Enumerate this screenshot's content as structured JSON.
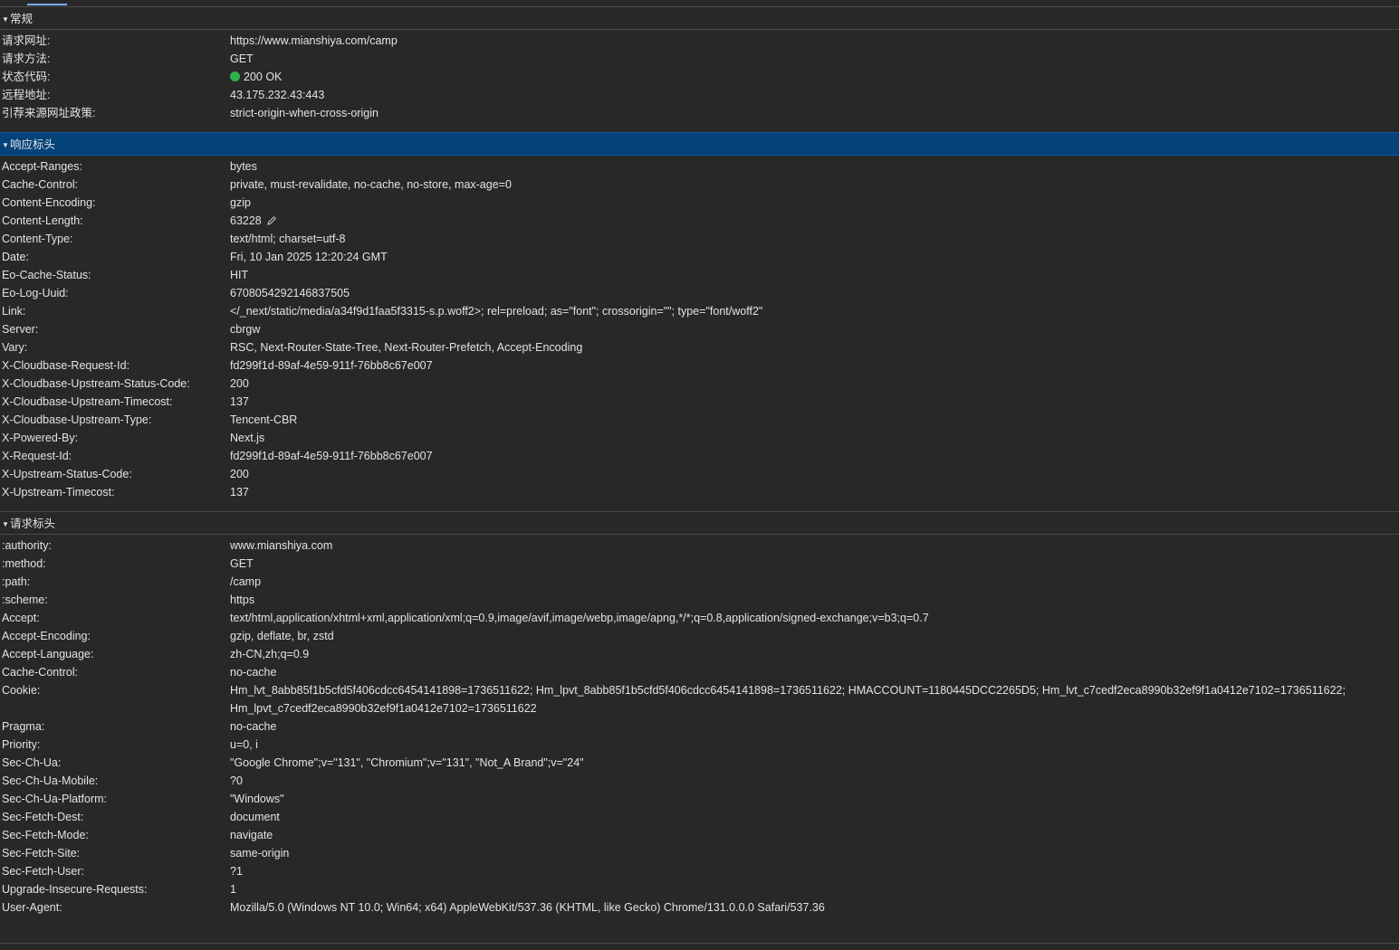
{
  "colors": {
    "background": "#282828",
    "selected_header": "#04427a",
    "status_ok": "#2fb14a"
  },
  "general": {
    "title": "常规",
    "rows": [
      {
        "k": "请求网址:",
        "v": "https://www.mianshiya.com/camp"
      },
      {
        "k": "请求方法:",
        "v": "GET"
      },
      {
        "k": "状态代码:",
        "v": "200 OK"
      },
      {
        "k": "远程地址:",
        "v": "43.175.232.43:443"
      },
      {
        "k": "引荐来源网址政策:",
        "v": "strict-origin-when-cross-origin"
      }
    ]
  },
  "response_headers": {
    "title": "响应标头",
    "rows": [
      {
        "k": "Accept-Ranges:",
        "v": "bytes"
      },
      {
        "k": "Cache-Control:",
        "v": "private, must-revalidate, no-cache, no-store, max-age=0"
      },
      {
        "k": "Content-Encoding:",
        "v": "gzip"
      },
      {
        "k": "Content-Length:",
        "v": "63228"
      },
      {
        "k": "Content-Type:",
        "v": "text/html; charset=utf-8"
      },
      {
        "k": "Date:",
        "v": "Fri, 10 Jan 2025 12:20:24 GMT"
      },
      {
        "k": "Eo-Cache-Status:",
        "v": "HIT"
      },
      {
        "k": "Eo-Log-Uuid:",
        "v": "6708054292146837505"
      },
      {
        "k": "Link:",
        "v": "</_next/static/media/a34f9d1faa5f3315-s.p.woff2>; rel=preload; as=\"font\"; crossorigin=\"\"; type=\"font/woff2\""
      },
      {
        "k": "Server:",
        "v": "cbrgw"
      },
      {
        "k": "Vary:",
        "v": "RSC, Next-Router-State-Tree, Next-Router-Prefetch, Accept-Encoding"
      },
      {
        "k": "X-Cloudbase-Request-Id:",
        "v": "fd299f1d-89af-4e59-911f-76bb8c67e007"
      },
      {
        "k": "X-Cloudbase-Upstream-Status-Code:",
        "v": "200"
      },
      {
        "k": "X-Cloudbase-Upstream-Timecost:",
        "v": "137"
      },
      {
        "k": "X-Cloudbase-Upstream-Type:",
        "v": "Tencent-CBR"
      },
      {
        "k": "X-Powered-By:",
        "v": "Next.js"
      },
      {
        "k": "X-Request-Id:",
        "v": "fd299f1d-89af-4e59-911f-76bb8c67e007"
      },
      {
        "k": "X-Upstream-Status-Code:",
        "v": "200"
      },
      {
        "k": "X-Upstream-Timecost:",
        "v": "137"
      }
    ]
  },
  "request_headers": {
    "title": "请求标头",
    "rows": [
      {
        "k": ":authority:",
        "v": "www.mianshiya.com"
      },
      {
        "k": ":method:",
        "v": "GET"
      },
      {
        "k": ":path:",
        "v": "/camp"
      },
      {
        "k": ":scheme:",
        "v": "https"
      },
      {
        "k": "Accept:",
        "v": "text/html,application/xhtml+xml,application/xml;q=0.9,image/avif,image/webp,image/apng,*/*;q=0.8,application/signed-exchange;v=b3;q=0.7"
      },
      {
        "k": "Accept-Encoding:",
        "v": "gzip, deflate, br, zstd"
      },
      {
        "k": "Accept-Language:",
        "v": "zh-CN,zh;q=0.9"
      },
      {
        "k": "Cache-Control:",
        "v": "no-cache"
      },
      {
        "k": "Cookie:",
        "v": "Hm_lvt_8abb85f1b5cfd5f406cdcc6454141898=1736511622; Hm_lpvt_8abb85f1b5cfd5f406cdcc6454141898=1736511622; HMACCOUNT=1180445DCC2265D5; Hm_lvt_c7cedf2eca8990b32ef9f1a0412e7102=1736511622; Hm_lpvt_c7cedf2eca8990b32ef9f1a0412e7102=1736511622"
      },
      {
        "k": "Pragma:",
        "v": "no-cache"
      },
      {
        "k": "Priority:",
        "v": "u=0, i"
      },
      {
        "k": "Sec-Ch-Ua:",
        "v": "\"Google Chrome\";v=\"131\", \"Chromium\";v=\"131\", \"Not_A Brand\";v=\"24\""
      },
      {
        "k": "Sec-Ch-Ua-Mobile:",
        "v": "?0"
      },
      {
        "k": "Sec-Ch-Ua-Platform:",
        "v": "\"Windows\""
      },
      {
        "k": "Sec-Fetch-Dest:",
        "v": "document"
      },
      {
        "k": "Sec-Fetch-Mode:",
        "v": "navigate"
      },
      {
        "k": "Sec-Fetch-Site:",
        "v": "same-origin"
      },
      {
        "k": "Sec-Fetch-User:",
        "v": "?1"
      },
      {
        "k": "Upgrade-Insecure-Requests:",
        "v": "1"
      },
      {
        "k": "User-Agent:",
        "v": "Mozilla/5.0 (Windows NT 10.0; Win64; x64) AppleWebKit/537.36 (KHTML, like Gecko) Chrome/131.0.0.0 Safari/537.36"
      }
    ]
  }
}
